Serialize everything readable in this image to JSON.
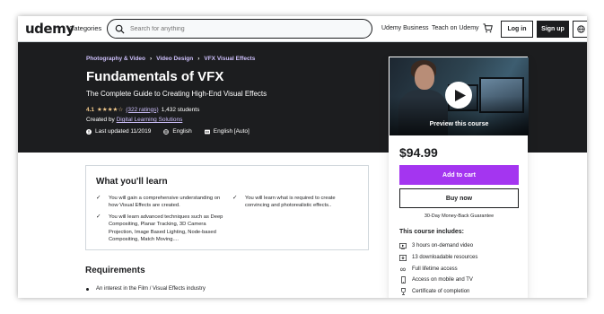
{
  "header": {
    "logo": "udemy",
    "categories": "Categories",
    "search_placeholder": "Search for anything",
    "business": "Udemy Business",
    "teach": "Teach on Udemy",
    "login": "Log in",
    "signup": "Sign up"
  },
  "course": {
    "breadcrumb": [
      "Photography & Video",
      "Video Design",
      "VFX Visual Effects"
    ],
    "title": "Fundamentals of VFX",
    "subtitle": "The Complete Guide to Creating High-End Visual Effects",
    "rating": "4.1",
    "stars": "★★★★☆",
    "ratings_count": "(322 ratings)",
    "students": "1,432 students",
    "created_by_label": "Created by",
    "author": "Digital Learning Solutions",
    "last_updated": "Last updated 11/2019",
    "language": "English",
    "captions": "English [Auto]"
  },
  "sidebar": {
    "preview_label": "Preview this course",
    "price": "$94.99",
    "add_to_cart": "Add to cart",
    "buy_now": "Buy now",
    "guarantee": "30-Day Money-Back Guarantee",
    "includes_title": "This course includes:",
    "includes": [
      {
        "icon": "video-icon",
        "text": "3 hours on-demand video"
      },
      {
        "icon": "download-icon",
        "text": "13 downloadable resources"
      },
      {
        "icon": "infinity-icon",
        "text": "Full lifetime access"
      },
      {
        "icon": "mobile-icon",
        "text": "Access on mobile and TV"
      },
      {
        "icon": "trophy-icon",
        "text": "Certificate of completion"
      }
    ]
  },
  "learn": {
    "title": "What you'll learn",
    "items": [
      "You will gain a comprehensive understanding on how Visual Effects are created.",
      "You will learn what is required to create convincing and photorealistic effects..",
      "You will learn advanced techniques such as Deep Compositing, Planar Tracking, 3D Camera Projection, Image Based Lighting, Node-based Compositing, Match Moving...."
    ]
  },
  "requirements": {
    "title": "Requirements",
    "items": [
      "An interest in the Film / Visual Effects industry"
    ]
  },
  "colors": {
    "accent": "#a435f0",
    "dark_bg": "#1c1d1f",
    "link_light": "#cec0fc",
    "star": "#f3ca8c"
  }
}
